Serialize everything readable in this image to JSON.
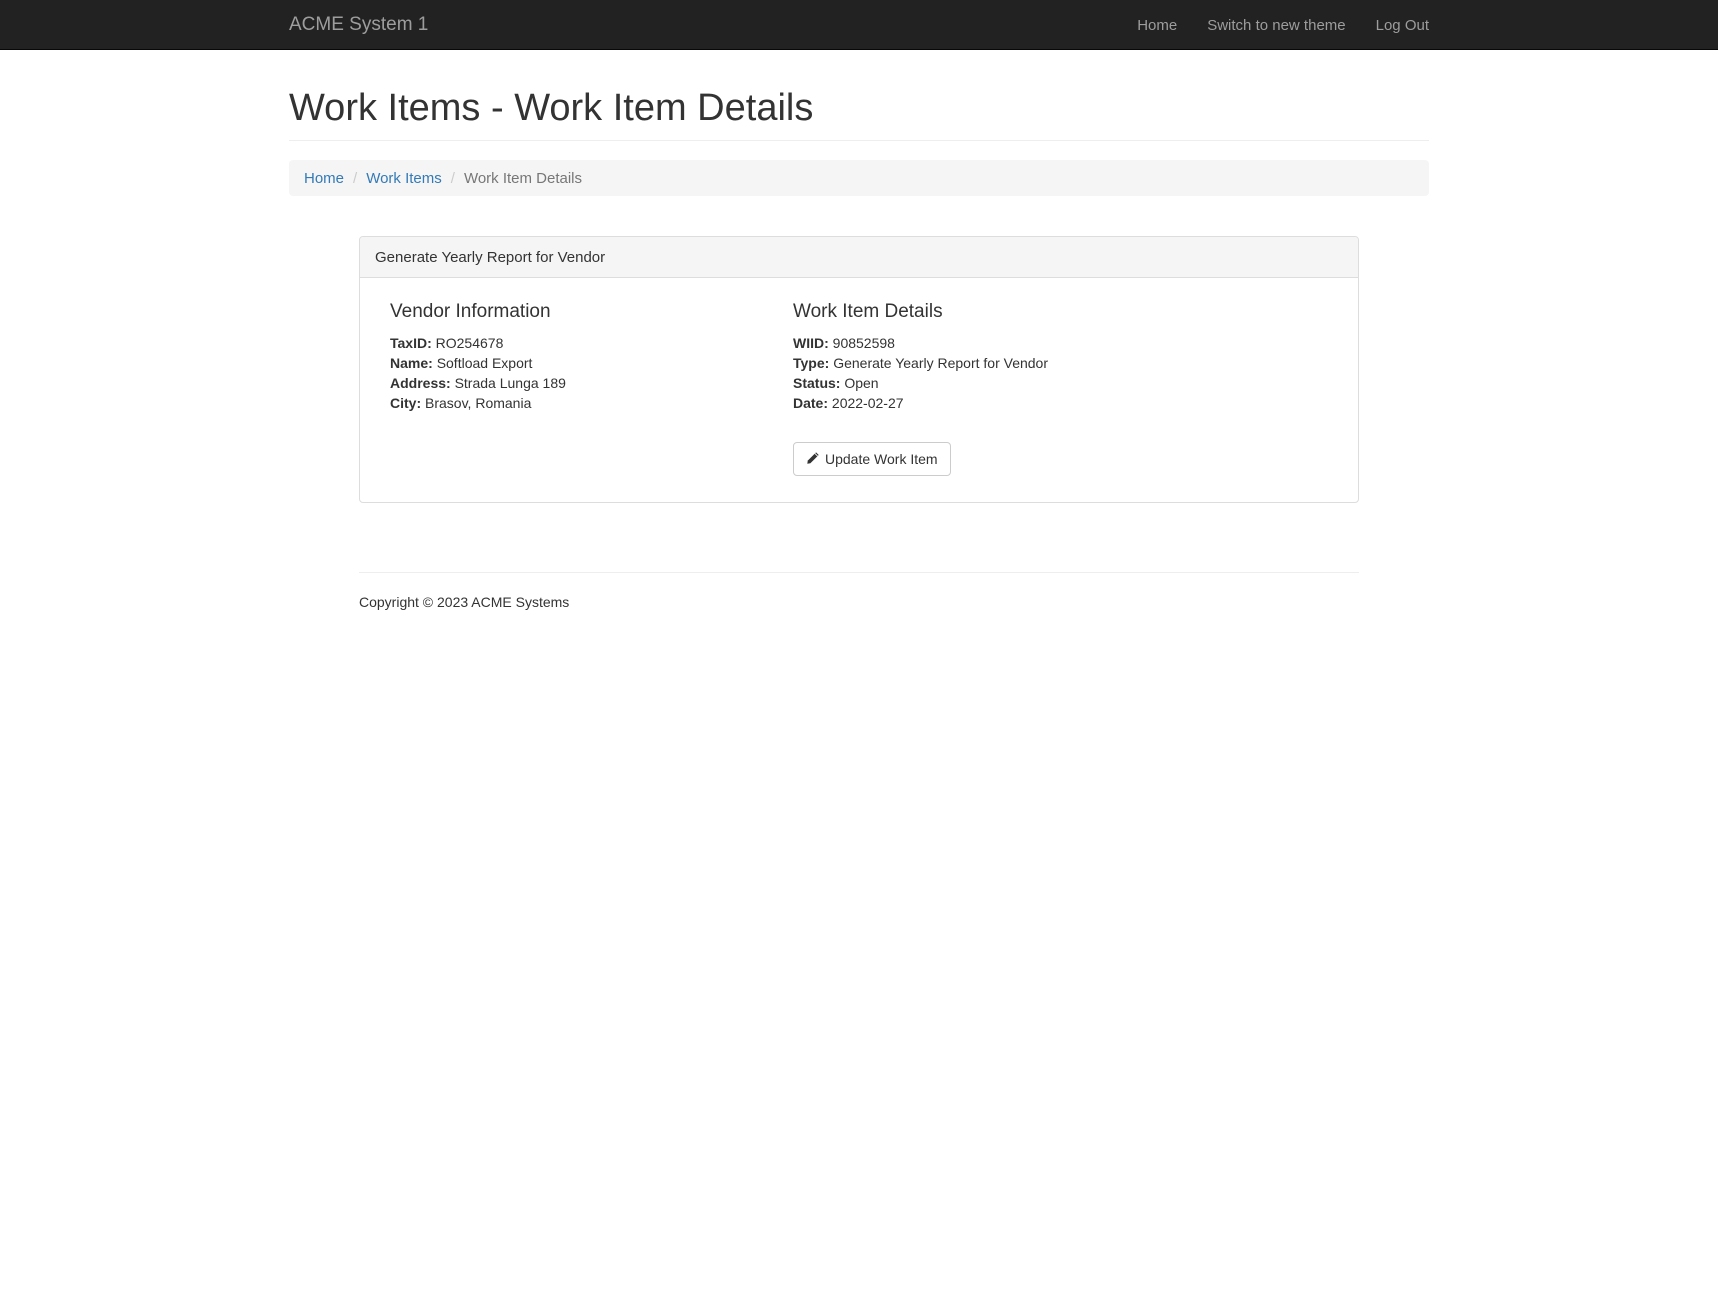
{
  "navbar": {
    "brand": "ACME System 1",
    "links": [
      "Home",
      "Switch to new theme",
      "Log Out"
    ]
  },
  "page": {
    "title": "Work Items - Work Item Details"
  },
  "breadcrumb": {
    "items": [
      "Home",
      "Work Items"
    ],
    "separator": "/",
    "active": "Work Item Details"
  },
  "panel": {
    "heading": "Generate Yearly Report for Vendor",
    "vendor": {
      "title": "Vendor Information",
      "fields": [
        {
          "label": "TaxID:",
          "value": "RO254678"
        },
        {
          "label": "Name:",
          "value": "Softload Export"
        },
        {
          "label": "Address:",
          "value": "Strada Lunga 189"
        },
        {
          "label": "City:",
          "value": "Brasov, Romania"
        }
      ]
    },
    "details": {
      "title": "Work Item Details",
      "fields": [
        {
          "label": "WIID:",
          "value": "90852598"
        },
        {
          "label": "Type:",
          "value": "Generate Yearly Report for Vendor"
        },
        {
          "label": "Status:",
          "value": "Open"
        },
        {
          "label": "Date:",
          "value": "2022-02-27"
        }
      ]
    },
    "update_button": {
      "label": "Update Work Item",
      "icon": "pencil-icon"
    }
  },
  "footer": {
    "text": "Copyright © 2023 ACME Systems"
  },
  "colors": {
    "navbar_bg": "#222222",
    "navbar_text": "#9d9d9d",
    "link": "#337ab7",
    "breadcrumb_bg": "#f5f5f5",
    "panel_heading_bg": "#f5f5f5",
    "panel_border": "#dddddd"
  }
}
